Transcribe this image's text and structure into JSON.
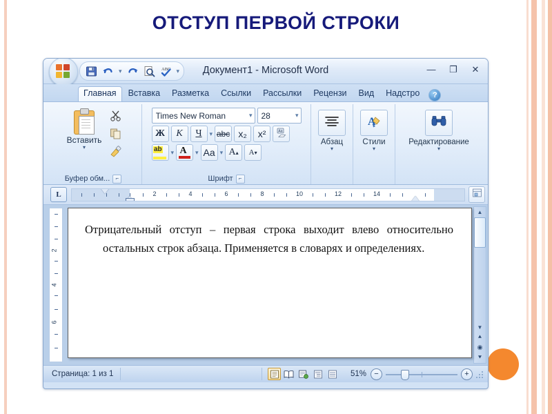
{
  "slide": {
    "title": "ОТСТУП ПЕРВОЙ СТРОКИ",
    "title_color": "#161a7a",
    "accent_color": "#f4882e",
    "border_color": "#f5c3ab"
  },
  "window": {
    "title": "Документ1 - Microsoft Word",
    "office_orb": "office-orb-icon",
    "quick_access": [
      {
        "name": "save-icon",
        "glyph": "save"
      },
      {
        "name": "undo-icon",
        "glyph": "undo"
      },
      {
        "name": "undo-dropdown-icon",
        "glyph": "caret"
      },
      {
        "name": "redo-icon",
        "glyph": "redo"
      },
      {
        "name": "print-preview-icon",
        "glyph": "preview"
      },
      {
        "name": "spelling-icon",
        "glyph": "abc-check"
      },
      {
        "name": "customize-qat-icon",
        "glyph": "caret"
      }
    ],
    "controls": {
      "minimize": "—",
      "maximize": "❐",
      "close": "✕"
    }
  },
  "tabs": [
    {
      "label": "Главная",
      "active": true
    },
    {
      "label": "Вставка",
      "active": false
    },
    {
      "label": "Разметка",
      "active": false
    },
    {
      "label": "Ссылки",
      "active": false
    },
    {
      "label": "Рассылки",
      "active": false
    },
    {
      "label": "Рецензи",
      "active": false
    },
    {
      "label": "Вид",
      "active": false
    },
    {
      "label": "Надстро",
      "active": false
    }
  ],
  "help_button": "?",
  "ribbon": {
    "clipboard": {
      "paste_label": "Вставить",
      "group_label": "Буфер обм...",
      "cut_label": "Вырезать",
      "copy_label": "Копировать",
      "format_painter_label": "Формат по образцу"
    },
    "font": {
      "group_label": "Шрифт",
      "font_name": "Times New Roman",
      "font_size": "28",
      "bold": "Ж",
      "italic": "К",
      "underline": "Ч",
      "strikethrough": "abc",
      "subscript": "x₂",
      "superscript": "x²",
      "clear_format": "Aa",
      "highlight": "ab",
      "font_color": "A",
      "change_case": "Aa",
      "grow_font": "A",
      "shrink_font": "A"
    },
    "paragraph": {
      "label": "Абзац"
    },
    "styles": {
      "label": "Стили"
    },
    "editing": {
      "label": "Редактирование"
    }
  },
  "ruler": {
    "tab_stop": "L",
    "horizontal_numbers": [
      "2",
      "4",
      "6",
      "8",
      "10",
      "12",
      "14"
    ],
    "vertical_numbers": [
      "2",
      "4",
      "6"
    ]
  },
  "document": {
    "paragraph": "Отрицательный отступ – первая строка выходит влево относительно остальных строк абзаца. Применяется в словарях и определениях."
  },
  "status_bar": {
    "page_info": "Страница: 1 из 1",
    "views": [
      {
        "name": "print-layout-view-icon",
        "active": true
      },
      {
        "name": "full-screen-reading-view-icon",
        "active": false
      },
      {
        "name": "web-layout-view-icon",
        "active": false
      },
      {
        "name": "outline-view-icon",
        "active": false
      },
      {
        "name": "draft-view-icon",
        "active": false
      }
    ],
    "zoom": "51%",
    "zoom_out": "−",
    "zoom_in": "+"
  },
  "scrollbar": {
    "up": "▲",
    "down": "▼",
    "prev_object": "⯅",
    "select_object": "◉",
    "next_object": "⯆"
  }
}
